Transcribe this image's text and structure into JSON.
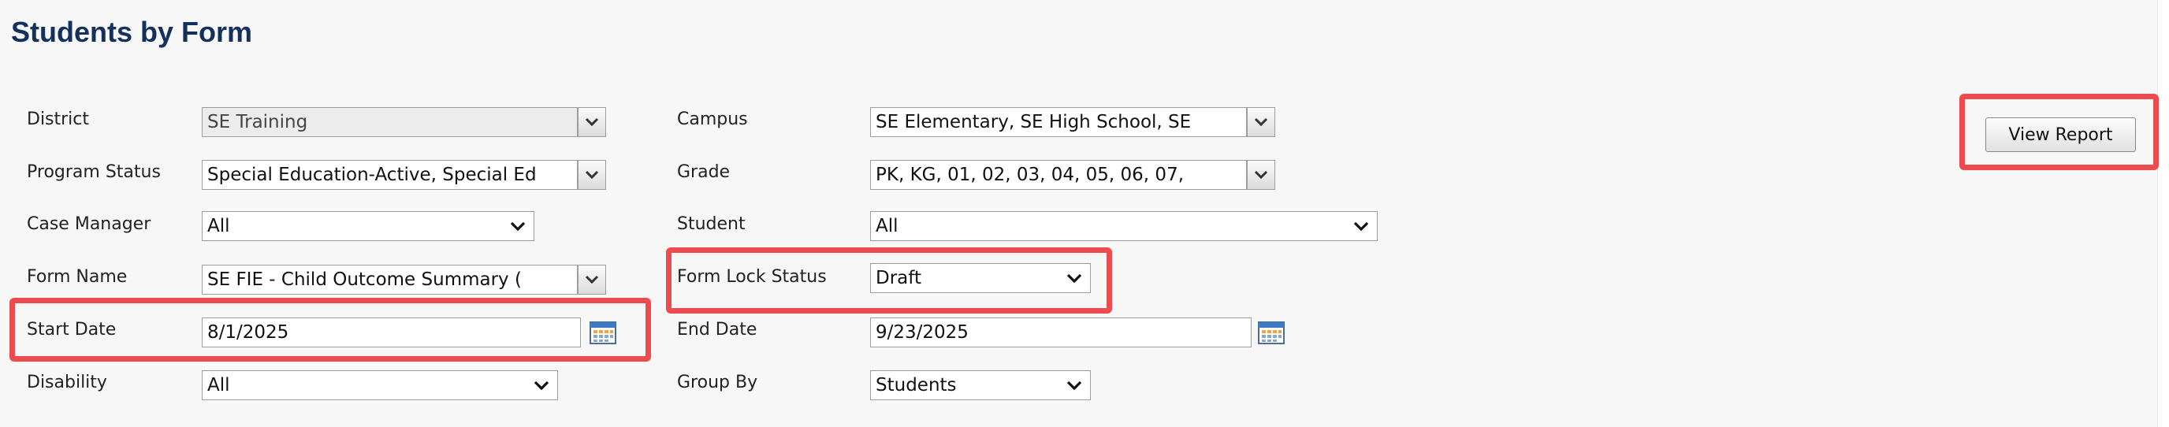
{
  "page": {
    "title": "Students by Form"
  },
  "filters": {
    "district": {
      "label": "District",
      "value": "SE Training"
    },
    "program_status": {
      "label": "Program Status",
      "value": "Special Education-Active, Special Ed"
    },
    "case_manager": {
      "label": "Case Manager",
      "value": "All"
    },
    "form_name": {
      "label": "Form Name",
      "value": "SE FIE - Child Outcome Summary ("
    },
    "start_date": {
      "label": "Start Date",
      "value": "8/1/2025"
    },
    "disability": {
      "label": "Disability",
      "value": "All"
    },
    "campus": {
      "label": "Campus",
      "value": "SE Elementary, SE High School, SE"
    },
    "grade": {
      "label": "Grade",
      "value": "PK, KG, 01, 02, 03, 04, 05, 06, 07,"
    },
    "student": {
      "label": "Student",
      "value": "All"
    },
    "form_lock_status": {
      "label": "Form Lock Status",
      "value": "Draft"
    },
    "end_date": {
      "label": "End Date",
      "value": "9/23/2025"
    },
    "group_by": {
      "label": "Group By",
      "value": "Students"
    }
  },
  "actions": {
    "view_report_label": "View Report"
  },
  "icons": {
    "dropdown": "chevron-down-icon",
    "calendar": "calendar-icon"
  },
  "colors": {
    "title": "#13315c",
    "highlight": "#ee4b4f",
    "panel_background": "#f7f7f7"
  }
}
